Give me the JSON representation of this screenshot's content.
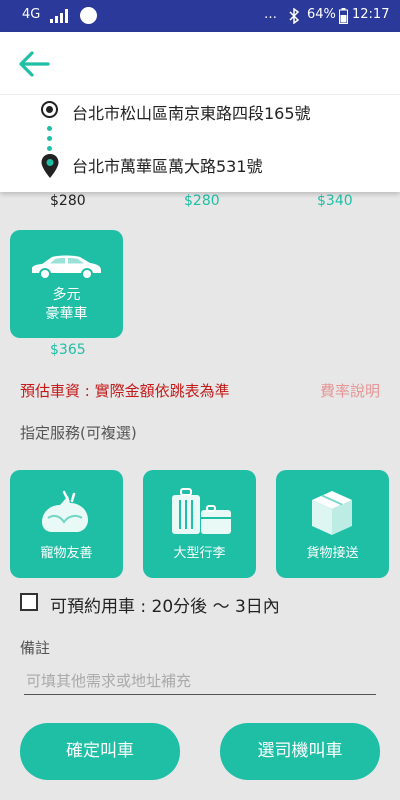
{
  "status_bar": {
    "network": "4G",
    "battery": "64%",
    "time": "12:17"
  },
  "route": {
    "origin": "台北市松山區南京東路四段165號",
    "destination": "台北市萬華區萬大路531號"
  },
  "prices_top": [
    "$280",
    "$280",
    "$340"
  ],
  "car_option": {
    "line1": "多元",
    "line2": "豪華車",
    "price": "$365"
  },
  "notice": "預估車資 : 實際金額依跳表為準",
  "rate_link": "費率說明",
  "services_title": "指定服務(可複選)",
  "services": [
    {
      "label": "寵物友善",
      "icon": "pet-icon"
    },
    {
      "label": "大型行李",
      "icon": "luggage-icon"
    },
    {
      "label": "貨物接送",
      "icon": "package-icon"
    }
  ],
  "reserve": {
    "label": "可預約用車 : 20分後 ～ 3日內",
    "checked": false
  },
  "note": {
    "label": "備註",
    "placeholder": "可填其他需求或地址補充",
    "value": ""
  },
  "buttons": {
    "confirm": "確定叫車",
    "choose_driver": "選司機叫車"
  },
  "colors": {
    "accent": "#1fbfa6",
    "status_bar": "#2b3a9a",
    "notice": "#c41a1a",
    "rate_link": "#e79595"
  }
}
